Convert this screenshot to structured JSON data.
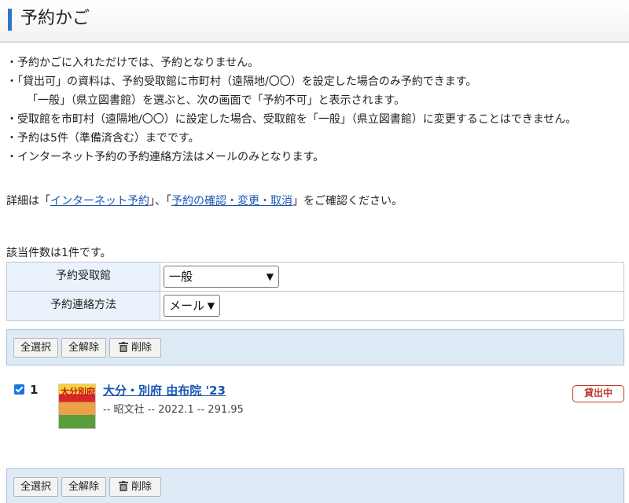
{
  "page": {
    "title": "予約かご"
  },
  "notes": [
    "・予約かごに入れただけでは、予約となりません。",
    "・「貸出可」の資料は、予約受取館に市町村（遠隔地/〇〇）を設定した場合のみ予約できます。",
    "「一般」（県立図書館）を選ぶと、次の画面で「予約不可」と表示されます。",
    "・受取館を市町村（遠隔地/〇〇）に設定した場合、受取館を「一般」（県立図書館）に変更することはできません。",
    "・予約は5件（準備済含む）までです。",
    "・インターネット予約の予約連絡方法はメールのみとなります。"
  ],
  "detail": {
    "prefix": "詳細は「",
    "link1": "インターネット予約",
    "middle": "」、「",
    "link2": "予約の確認・変更・取消",
    "suffix": "」をご確認ください。"
  },
  "result_count": "該当件数は1件です。",
  "settings": {
    "pickup_label": "予約受取館",
    "pickup_value": "一般",
    "contact_label": "予約連絡方法",
    "contact_value": "メール"
  },
  "toolbar": {
    "select_all": "全選択",
    "deselect_all": "全解除",
    "delete": "削除"
  },
  "items": [
    {
      "checked": true,
      "number": "1",
      "cover_text": "大分別府",
      "title": "大分・別府 由布院 '23",
      "meta": "-- 昭文社 -- 2022.1 -- 291.95",
      "status": "貸出中"
    }
  ],
  "colors": {
    "accent": "#2f76c8",
    "link": "#1a55b3",
    "status_lent": "#c0392b",
    "toolbar_bg": "#dfeaf7"
  },
  "icons": {
    "delete": "trash-icon"
  }
}
